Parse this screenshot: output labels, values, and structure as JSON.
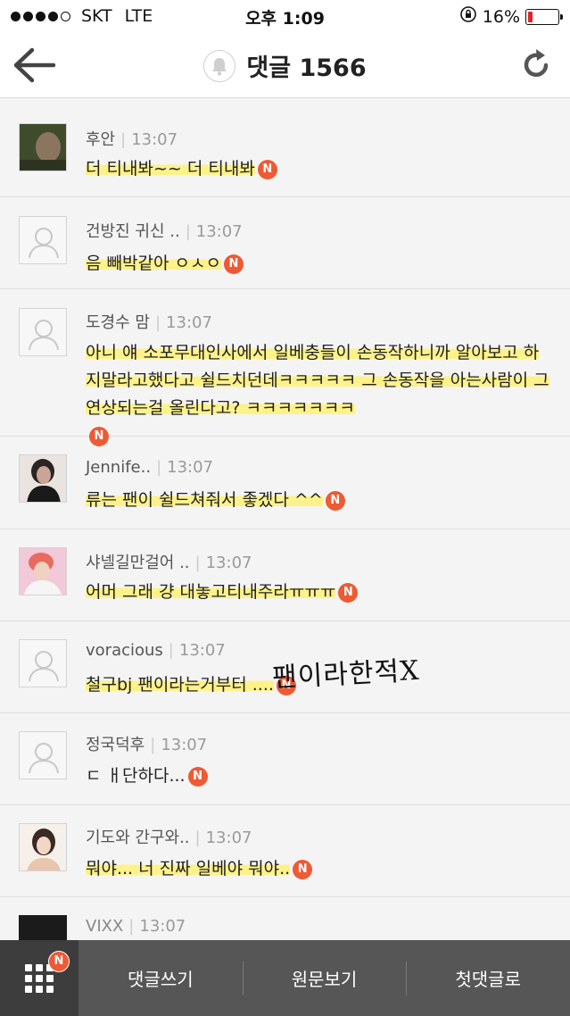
{
  "status": {
    "carrier": "SKT",
    "network": "LTE",
    "time": "오후 1:09",
    "battery": "16%",
    "battery_level": 0.16
  },
  "header": {
    "title": "댓글 1566"
  },
  "comments": [
    {
      "author": "후안",
      "time": "13:07",
      "text": "더 티내봐~~ 더 티내봐",
      "badge": "N",
      "avatar": "photo"
    },
    {
      "author": "건방진 귀신 ..",
      "time": "13:07",
      "text": "음 빼박같아 ㅇㅅㅇ",
      "badge": "N",
      "avatar": "default"
    },
    {
      "author": "도경수 맘",
      "time": "13:07",
      "text": "아니 얘 소포무대인사에서 일베충들이 손동작하니까 알아보고 하지말라고했다고 쉴드치던데ㅋㅋㅋㅋㅋ 그 손동작을 아는사람이 그 연상되는걸 올린다고? ㅋㅋㅋㅋㅋㅋㅋ",
      "badge": "N",
      "avatar": "default"
    },
    {
      "author": "Jennife..",
      "time": "13:07",
      "text": "류는 팬이 쉴드쳐줘서 좋겠다 ^^",
      "badge": "N",
      "avatar": "photo"
    },
    {
      "author": "샤넬길만걸어 ..",
      "time": "13:07",
      "text": "어머 그래 걍 대놓고티내주라ㅠㅠㅠ",
      "badge": "N",
      "avatar": "photo"
    },
    {
      "author": "voracious",
      "time": "13:07",
      "text": "철구bj 팬이라는거부터 ....",
      "badge": "N",
      "avatar": "default"
    },
    {
      "author": "정국덕후",
      "time": "13:07",
      "text": "ㄷ ㅐ단하다...",
      "badge": "N",
      "avatar": "default"
    },
    {
      "author": "기도와 간구와..",
      "time": "13:07",
      "text": "뭐야... 너 진짜 일베야 뭐야..",
      "badge": "N",
      "avatar": "photo"
    },
    {
      "author": "VIXX",
      "time": "13:07",
      "text": "",
      "badge": "",
      "avatar": "photo"
    }
  ],
  "annotation": "팬이라한적X",
  "bottom_bar": {
    "menu_badge": "N",
    "write": "댓글쓰기",
    "original": "원문보기",
    "first": "첫댓글로"
  },
  "colors": {
    "badge": "#ee5a34",
    "highlight": "#fff278",
    "bottom_bar": "#565656",
    "battery_low": "#e0262b"
  }
}
